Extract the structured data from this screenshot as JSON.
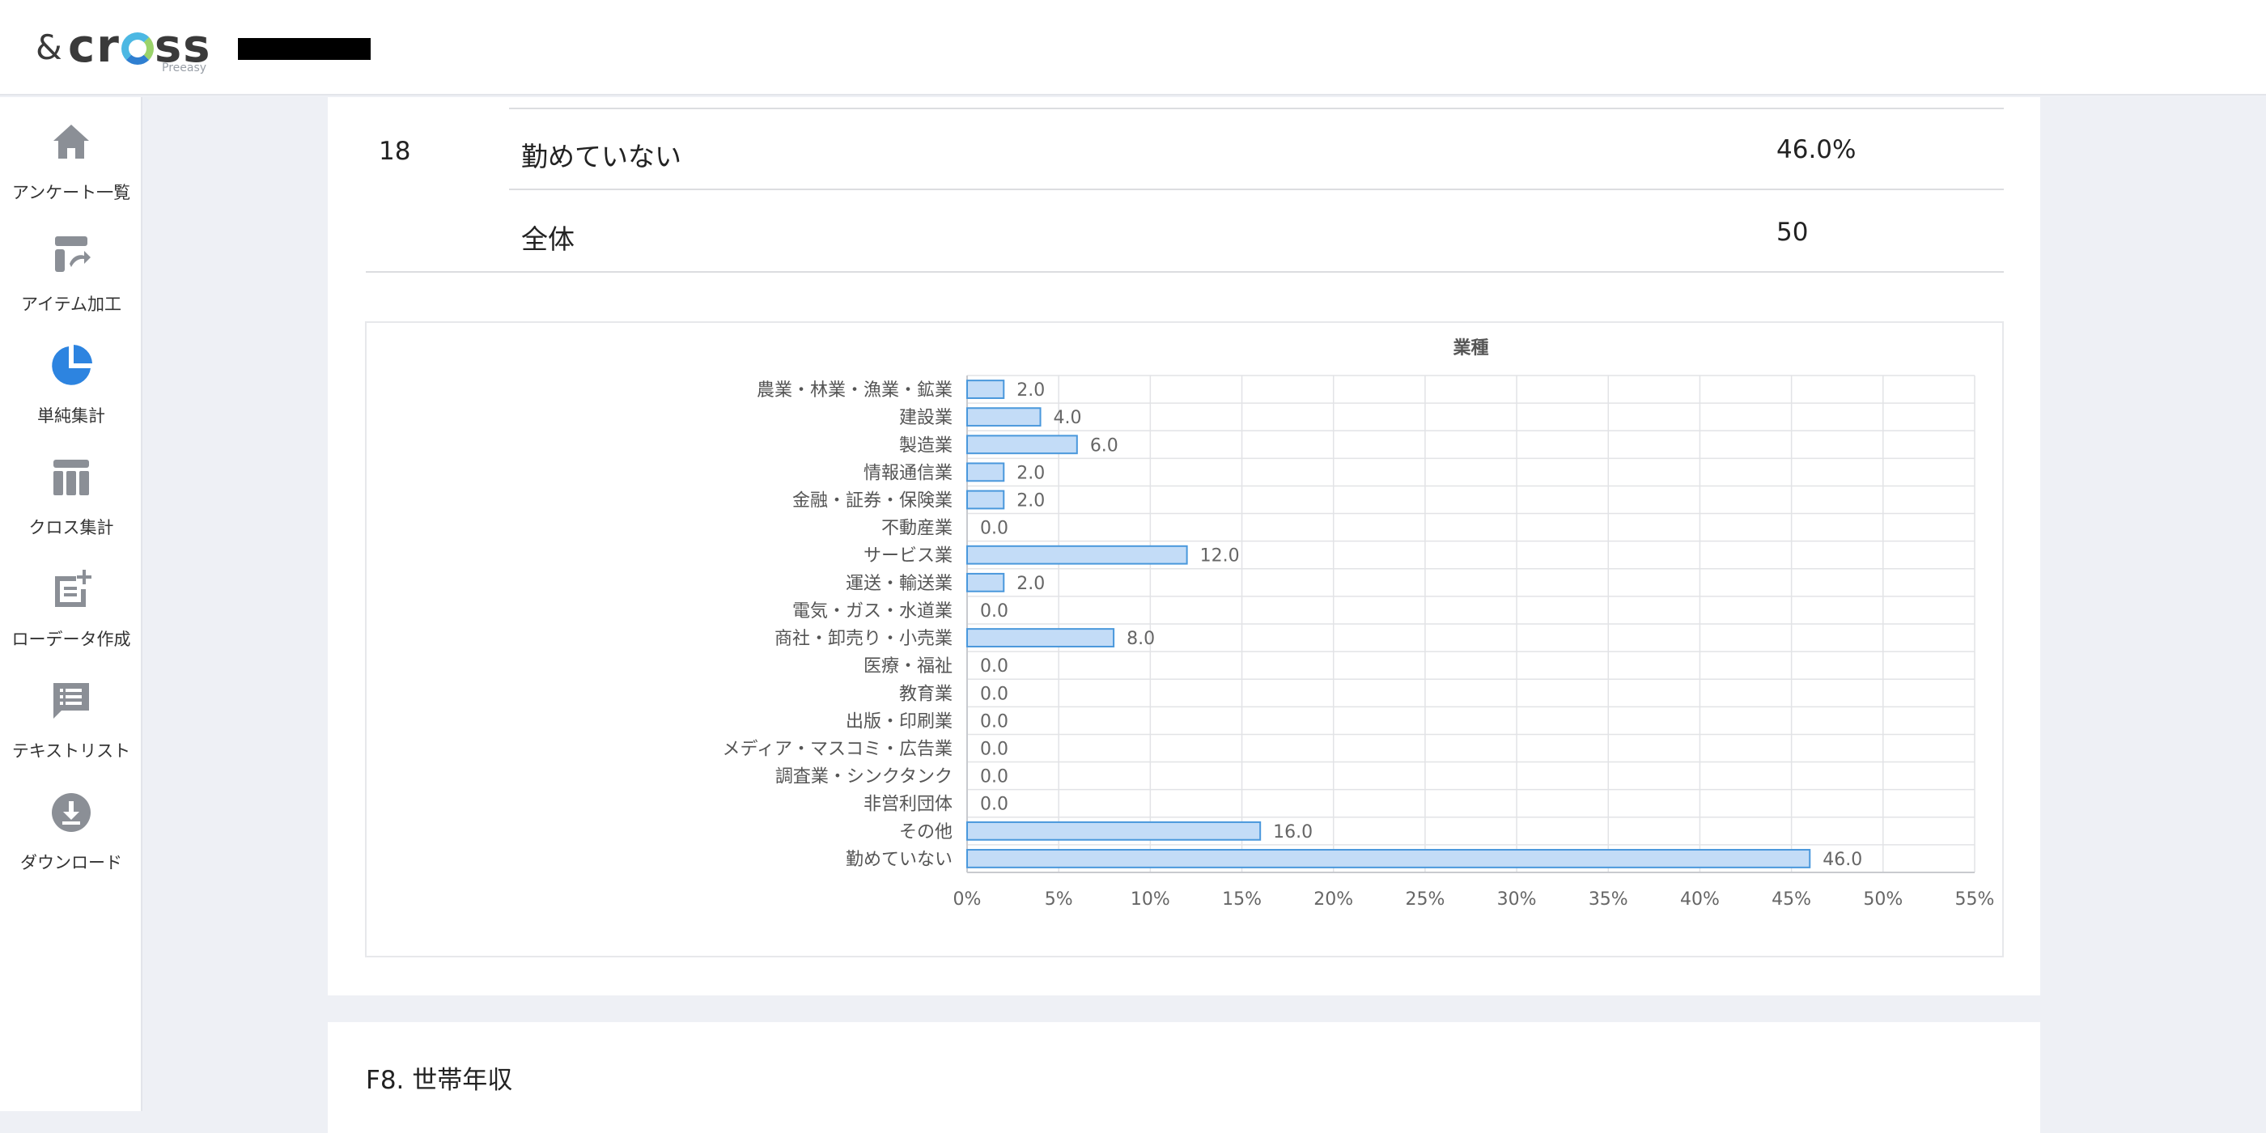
{
  "header": {
    "logo_amp": "&",
    "logo_c": "cr",
    "logo_tail": "ss",
    "logo_sub": "Preeasy"
  },
  "sidebar": {
    "items": [
      {
        "label": "アンケート一覧",
        "icon": "home-icon",
        "active": false
      },
      {
        "label": "アイテム加工",
        "icon": "item-edit-icon",
        "active": false
      },
      {
        "label": "単純集計",
        "icon": "pie-chart-icon",
        "active": true
      },
      {
        "label": "クロス集計",
        "icon": "table-icon",
        "active": false
      },
      {
        "label": "ローデータ作成",
        "icon": "raw-data-icon",
        "active": false
      },
      {
        "label": "テキストリスト",
        "icon": "text-list-icon",
        "active": false
      },
      {
        "label": "ダウンロード",
        "icon": "download-icon",
        "active": false
      }
    ]
  },
  "table": {
    "rows": [
      {
        "num": "18",
        "label": "勤めていない",
        "value": "46.0%"
      },
      {
        "num": "",
        "label": "全体",
        "value": "50"
      }
    ]
  },
  "colors": {
    "accent": "#2d84e0",
    "bar_fill": "#c3dcf7",
    "bar_stroke": "#4a98dc",
    "icon_gray": "#8b8f96"
  },
  "chart_data": {
    "type": "bar",
    "orientation": "horizontal",
    "title": "業種",
    "categories": [
      "農業・林業・漁業・鉱業",
      "建設業",
      "製造業",
      "情報通信業",
      "金融・証券・保険業",
      "不動産業",
      "サービス業",
      "運送・輸送業",
      "電気・ガス・水道業",
      "商社・卸売り・小売業",
      "医療・福祉",
      "教育業",
      "出版・印刷業",
      "メディア・マスコミ・広告業",
      "調査業・シンクタンク",
      "非営利団体",
      "その他",
      "勤めていない"
    ],
    "values": [
      2.0,
      4.0,
      6.0,
      2.0,
      2.0,
      0.0,
      12.0,
      2.0,
      0.0,
      8.0,
      0.0,
      0.0,
      0.0,
      0.0,
      0.0,
      0.0,
      16.0,
      46.0
    ],
    "value_labels": [
      "2.0",
      "4.0",
      "6.0",
      "2.0",
      "2.0",
      "0.0",
      "12.0",
      "2.0",
      "0.0",
      "8.0",
      "0.0",
      "0.0",
      "0.0",
      "0.0",
      "0.0",
      "0.0",
      "16.0",
      "46.0"
    ],
    "xticks": [
      "0%",
      "5%",
      "10%",
      "15%",
      "20%",
      "25%",
      "30%",
      "35%",
      "40%",
      "45%",
      "50%",
      "55%"
    ],
    "xlim": [
      0,
      55
    ],
    "grid": true,
    "legend": "none"
  },
  "next_section": {
    "title": "F8. 世帯年収"
  }
}
